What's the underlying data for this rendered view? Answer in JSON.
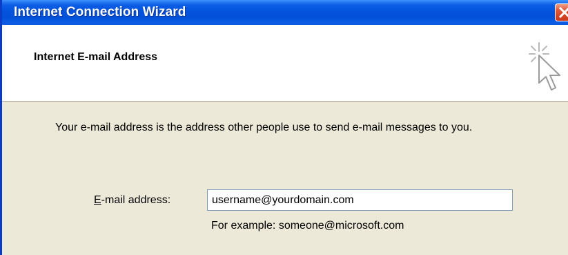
{
  "window": {
    "title": "Internet Connection Wizard"
  },
  "header": {
    "title": "Internet E-mail Address"
  },
  "body": {
    "description": "Your e-mail address is the address other people use to send e-mail messages to you.",
    "email_label_accel": "E",
    "email_label_rest": "-mail address:",
    "email_value": "username@yourdomain.com",
    "example": "For example: someone@microsoft.com"
  },
  "icons": {
    "close": "close-icon",
    "wizard": "wizard-cursor-icon"
  },
  "colors": {
    "titlebar": "#0453dd",
    "dialog_bg": "#ece9d8",
    "close_button": "#d44426"
  }
}
